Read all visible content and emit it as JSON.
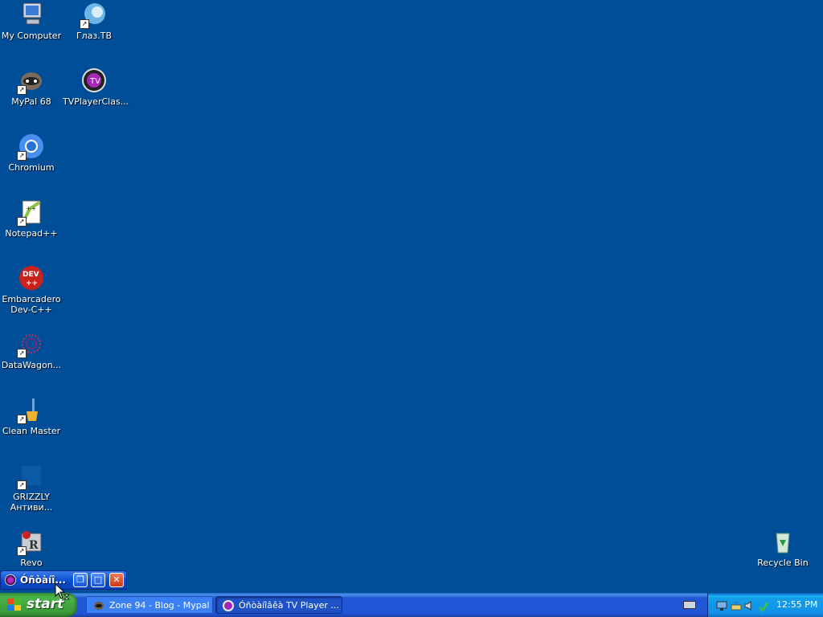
{
  "desktop_icons": [
    {
      "label": "My Computer",
      "icon": "my-computer-icon"
    },
    {
      "label": "Глаз.ТВ",
      "icon": "glaz-tv-icon"
    },
    {
      "label": "MyPal 68",
      "icon": "mypal-icon"
    },
    {
      "label": "TVPlayerClas...",
      "icon": "tvplayer-icon"
    },
    {
      "label": "Chromium",
      "icon": "chromium-icon"
    },
    {
      "label": "Notepad++",
      "icon": "notepadpp-icon"
    },
    {
      "label": "Embarcadero\nDev-C++",
      "icon": "devcpp-icon"
    },
    {
      "label": "DataWagon...",
      "icon": "datawagon-icon"
    },
    {
      "label": "Clean Master",
      "icon": "clean-master-icon"
    },
    {
      "label": "GRIZZLY\nАнтиви...",
      "icon": "grizzly-icon"
    },
    {
      "label": "Revo",
      "icon": "revo-icon"
    },
    {
      "label": "Recycle Bin",
      "icon": "recycle-bin-icon"
    }
  ],
  "minimized_window": {
    "title": "Óñòàíî..."
  },
  "taskbar": {
    "start_label": "start",
    "tasks": [
      {
        "label": "Zone 94 - Blog - Mypal",
        "icon": "mypal-icon",
        "active": false
      },
      {
        "label": "Óñòàíîâêà TV Player ...",
        "icon": "tvplayer-icon",
        "active": true
      }
    ],
    "clock": "12:55 PM"
  },
  "colors": {
    "desktop": "#004e98",
    "taskbar": "#2157d7",
    "start": "#3a9b3a",
    "tray": "#1290e8"
  }
}
